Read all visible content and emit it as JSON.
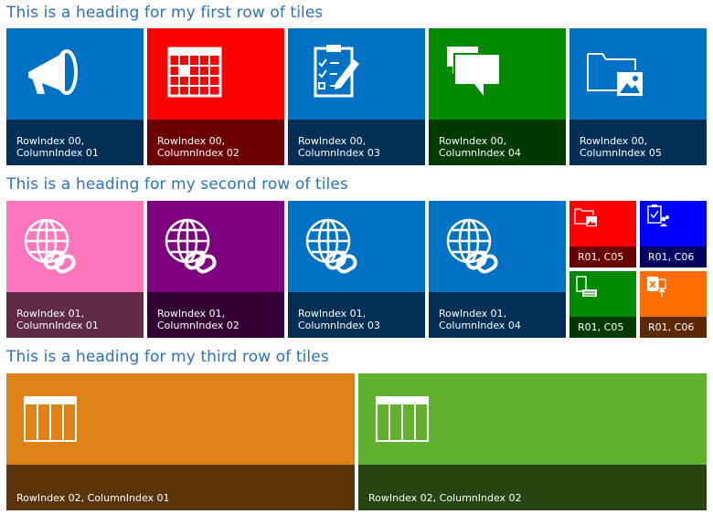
{
  "rows": [
    {
      "heading": "This is a heading for my first row of tiles",
      "tiles": [
        {
          "label_line1": "RowIndex 00,",
          "label_line2": "ColumnIndex 01",
          "icon": "megaphone-icon",
          "color": "#0072c6",
          "label_color": "#002f56"
        },
        {
          "label_line1": "RowIndex 00,",
          "label_line2": "ColumnIndex 02",
          "icon": "calendar-icon",
          "color": "#ff0000",
          "label_color": "#6b0000"
        },
        {
          "label_line1": "RowIndex 00,",
          "label_line2": "ColumnIndex 03",
          "icon": "checklist-icon",
          "color": "#0072c6",
          "label_color": "#002f56"
        },
        {
          "label_line1": "RowIndex 00,",
          "label_line2": "ColumnIndex 04",
          "icon": "chat-icon",
          "color": "#008a00",
          "label_color": "#003a00"
        },
        {
          "label_line1": "RowIndex 00,",
          "label_line2": "ColumnIndex 05",
          "icon": "folder-image-icon",
          "color": "#0072c6",
          "label_color": "#002f56"
        }
      ]
    },
    {
      "heading": "This is a heading for my second row of tiles",
      "tiles": [
        {
          "label_line1": "RowIndex 01,",
          "label_line2": "ColumnIndex 01",
          "icon": "globe-link-icon",
          "color": "#ff76bc",
          "label_color": "#5e2a46"
        },
        {
          "label_line1": "RowIndex 01,",
          "label_line2": "ColumnIndex 02",
          "icon": "globe-link-icon",
          "color": "#7f007f",
          "label_color": "#330033"
        },
        {
          "label_line1": "RowIndex 01,",
          "label_line2": "ColumnIndex 03",
          "icon": "globe-link-icon",
          "color": "#0072c6",
          "label_color": "#002f56"
        },
        {
          "label_line1": "RowIndex 01,",
          "label_line2": "ColumnIndex 04",
          "icon": "globe-link-icon",
          "color": "#0072c6",
          "label_color": "#002f56"
        }
      ],
      "small_tiles": [
        {
          "label": "R01, C05",
          "icon": "folder-image-icon",
          "color": "#ff0000",
          "label_color": "#6b0000"
        },
        {
          "label": "R01, C06",
          "icon": "task-people-icon",
          "color": "#0000ff",
          "label_color": "#000060"
        },
        {
          "label": "R01, C05",
          "icon": "computer-icon",
          "color": "#008a00",
          "label_color": "#003a00"
        },
        {
          "label": "R01, C06",
          "icon": "excel-share-icon",
          "color": "#ff6d00",
          "label_color": "#5c2800"
        }
      ]
    },
    {
      "heading": "This is a heading for my third row of tiles",
      "tiles": [
        {
          "label": "RowIndex 02, ColumnIndex 01",
          "icon": "table-icon",
          "color": "#de8116",
          "label_color": "#5b3509"
        },
        {
          "label": "RowIndex 02, ColumnIndex 02",
          "icon": "table-icon",
          "color": "#5fb12e",
          "label_color": "#264512"
        }
      ]
    }
  ]
}
